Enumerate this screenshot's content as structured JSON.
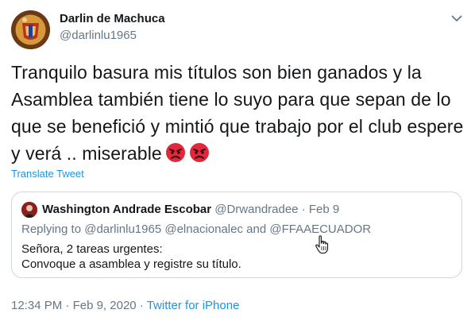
{
  "author": {
    "display_name": "Darlin de Machuca",
    "handle": "@darlinlu1965"
  },
  "icons": {
    "caret": "chevron-down-icon",
    "emoji": "pouting-face-emoji",
    "cursor": "hand-pointer-cursor"
  },
  "tweet": {
    "text": "Tranquilo basura mis títulos son bien ganados y la Asamblea también tiene lo suyo para que sepan de lo que se benefició y mintió que trabajo por el club espere y verá .. miserable",
    "translate_label": "Translate Tweet"
  },
  "quoted": {
    "name": "Washington Andrade Escobar",
    "handle": "@Drwandradee",
    "separator": "·",
    "date": "Feb 9",
    "replying_prefix": "Replying to",
    "replying_to_1": "@darlinlu1965",
    "replying_to_2": "@elnacionalec",
    "replying_and": "and",
    "replying_to_3": "@FFAAECUADOR",
    "line1": "Señora, 2 tareas urgentes:",
    "line2": "Convoque a asamblea y registre su título."
  },
  "footer": {
    "time": "12:34 PM",
    "separator": "·",
    "date": "Feb 9, 2020",
    "source": "Twitter for iPhone"
  },
  "colors": {
    "link": "#1b95e0",
    "muted": "#657786",
    "text": "#14171a",
    "border": "#ccd6dd",
    "emoji_red": "#e0283c"
  }
}
